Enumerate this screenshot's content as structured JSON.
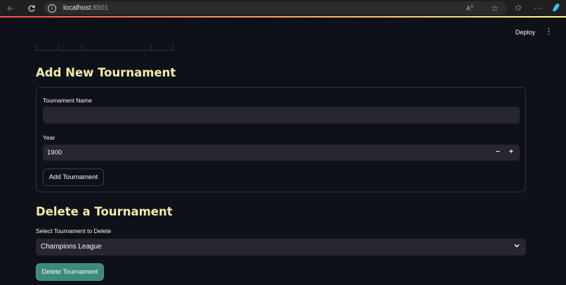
{
  "browser": {
    "url_host": "localhost",
    "url_port": ":8501",
    "read_aloud_label": "A",
    "read_aloud_sup": "A"
  },
  "app": {
    "deploy_label": "Deploy",
    "menu_icon": "⋮"
  },
  "add_section": {
    "title": "Add New Tournament",
    "name_label": "Tournament Name",
    "name_value": "",
    "year_label": "Year",
    "year_value": "1900",
    "decrement": "−",
    "increment": "+",
    "submit_label": "Add Tournament"
  },
  "delete_section": {
    "title": "Delete a Tournament",
    "select_label": "Select Tournament to Delete",
    "selected_value": "Champions League",
    "submit_label": "Delete Tournament"
  },
  "colors": {
    "background": "#0e1117",
    "heading": "#f2eba9",
    "primary_button": "#3c8a79",
    "input_bg": "#262730"
  }
}
